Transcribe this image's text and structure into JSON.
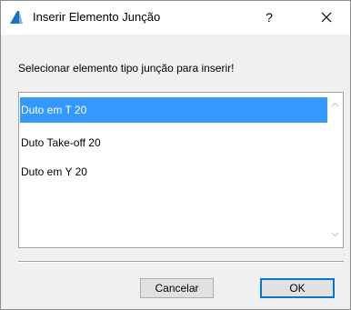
{
  "window": {
    "title": "Inserir Elemento Junção",
    "help_label": "?",
    "app_icon": "archicad-icon",
    "close_icon": "close-icon"
  },
  "instruction": "Selecionar elemento tipo junção para inserir!",
  "list": {
    "items": [
      {
        "label": "Duto em T 20",
        "selected": true
      },
      {
        "label": "Duto Take-off 20",
        "selected": false
      },
      {
        "label": "Duto em Y 20",
        "selected": false
      }
    ],
    "scroll_up_icon": "chevron-up-icon",
    "scroll_down_icon": "chevron-down-icon"
  },
  "buttons": {
    "cancel": "Cancelar",
    "ok": "OK"
  },
  "colors": {
    "selection": "#3399ff",
    "default_button_border": "#0078d7",
    "dialog_background": "#f0f0f0"
  }
}
